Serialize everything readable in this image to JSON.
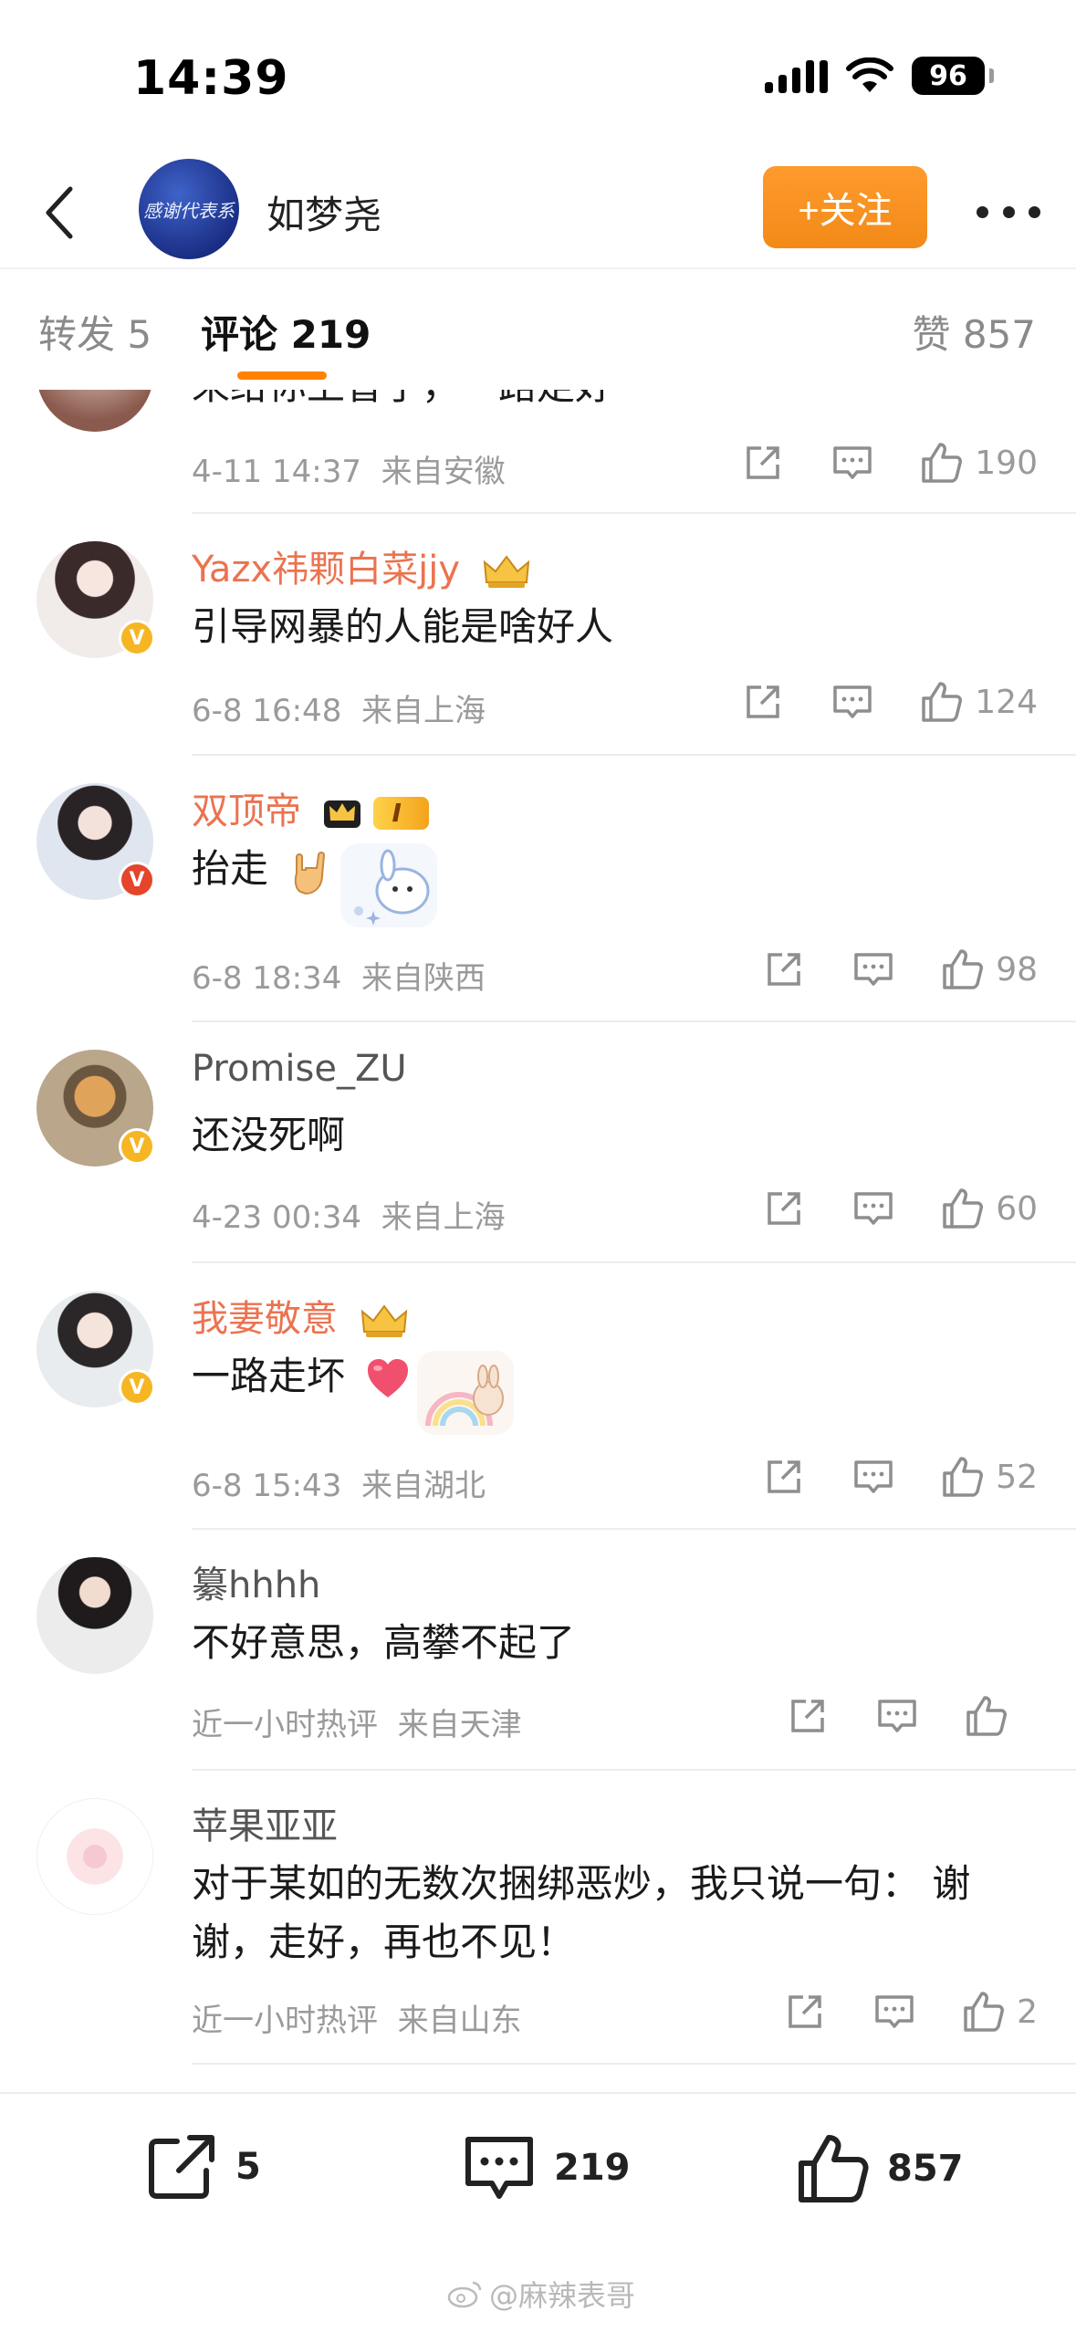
{
  "status_bar": {
    "time": "14:39",
    "battery": "96"
  },
  "header": {
    "avatar_text": "感谢代表系",
    "user_name": "如梦尧",
    "follow_label": "+关注"
  },
  "tabs": {
    "repost": "转发 5",
    "comment": "评论 219",
    "like": "赞 857"
  },
  "comments": [
    {
      "username": "",
      "text": "来给你上香了，一路走好",
      "time": "4-11 14:37",
      "location": "来自安徽",
      "likes": "190"
    },
    {
      "username": "Yazx祎颗白菜jjy",
      "text": "引导网暴的人能是啥好人",
      "time": "6-8 16:48",
      "location": "来自上海",
      "likes": "124"
    },
    {
      "username": "双顶帝",
      "text": "抬走",
      "time": "6-8 18:34",
      "location": "来自陕西",
      "likes": "98",
      "badge_text": "I"
    },
    {
      "username": "Promise_ZU",
      "text": "还没死啊",
      "time": "4-23 00:34",
      "location": "来自上海",
      "likes": "60"
    },
    {
      "username": "我妻敬意",
      "text": "一路走坏",
      "time": "6-8 15:43",
      "location": "来自湖北",
      "likes": "52"
    },
    {
      "username": "纂hhhh",
      "text": "不好意思，高攀不起了",
      "time": "近一小时热评",
      "location": "来自天津",
      "likes": ""
    },
    {
      "username": "苹果亚亚",
      "text": "对于某如的无数次捆绑恶炒，我只说一句： 谢谢，走好，再也不见！",
      "time": "近一小时热评",
      "location": "来自山东",
      "likes": "2"
    }
  ],
  "bottom_bar": {
    "repost_count": "5",
    "comment_count": "219",
    "like_count": "857",
    "watermark": "@麻辣表哥"
  },
  "colors": {
    "accent": "#ff8200",
    "vip_name": "#eb7350",
    "follow_button": "#f28a17"
  }
}
